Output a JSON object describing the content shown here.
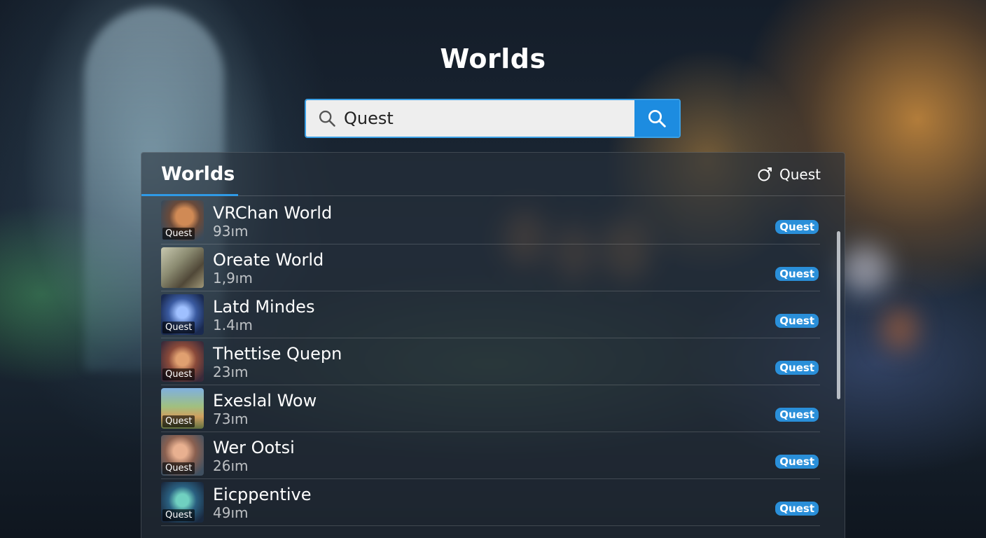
{
  "page": {
    "title": "Worlds"
  },
  "search": {
    "value": "Quest",
    "placeholder": ""
  },
  "panel": {
    "title": "Worlds",
    "filter_label": "Quest"
  },
  "worlds": [
    {
      "name": "VRChan World",
      "meta": "93ım",
      "tag": "Quest",
      "thumb_badge": "Quest"
    },
    {
      "name": "Oreate World",
      "meta": "1,9ım",
      "tag": "Quest",
      "thumb_badge": ""
    },
    {
      "name": "Latd Mindes",
      "meta": "1.4ım",
      "tag": "Quest",
      "thumb_badge": "Quest"
    },
    {
      "name": "Thettise Quepn",
      "meta": "23ım",
      "tag": "Quest",
      "thumb_badge": "Quest"
    },
    {
      "name": "Exeslal Wow",
      "meta": "73ım",
      "tag": "Quest",
      "thumb_badge": "Quest"
    },
    {
      "name": "Wer Ootsi",
      "meta": "26ım",
      "tag": "Quest",
      "thumb_badge": "Quest"
    },
    {
      "name": "Eicppentive",
      "meta": "49ım",
      "tag": "Quest",
      "thumb_badge": "Quest"
    }
  ],
  "icons": {
    "search_field": "search-icon",
    "search_button": "search-icon",
    "filter": "headset-icon"
  },
  "colors": {
    "accent": "#1d8ce0",
    "tag": "#2a8fd9"
  }
}
